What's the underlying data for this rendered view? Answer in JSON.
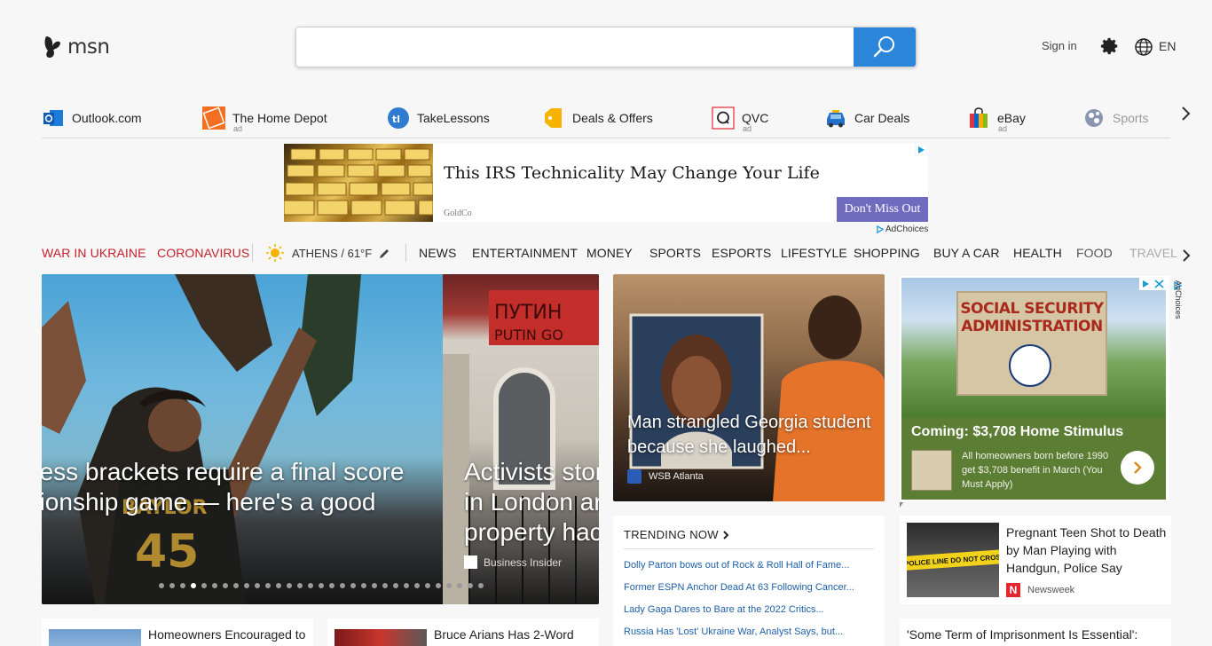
{
  "header": {
    "logo_text": "msn",
    "search_placeholder": "",
    "signin_label": "Sign in",
    "lang_label": "EN"
  },
  "quicklinks": [
    {
      "label": "Outlook.com",
      "icon": "outlook-icon",
      "ad": ""
    },
    {
      "label": "The Home Depot",
      "icon": "home-depot-icon",
      "ad": "ad"
    },
    {
      "label": "TakeLessons",
      "icon": "takelessons-icon",
      "ad": ""
    },
    {
      "label": "Deals & Offers",
      "icon": "deals-tag-icon",
      "ad": ""
    },
    {
      "label": "QVC",
      "icon": "qvc-icon",
      "ad": "ad"
    },
    {
      "label": "Car Deals",
      "icon": "car-icon",
      "ad": ""
    },
    {
      "label": "eBay",
      "icon": "ebay-bag-icon",
      "ad": "ad"
    },
    {
      "label": "Sports",
      "icon": "sports-ball-icon",
      "ad": ""
    }
  ],
  "banner_ad": {
    "title": "This IRS Technicality May Change Your Life",
    "source": "GoldCo",
    "cta": "Don't Miss Out",
    "adchoices": "AdChoices"
  },
  "nav": {
    "items": [
      "WAR IN UKRAINE",
      "CORONAVIRUS",
      "NEWS",
      "ENTERTAINMENT",
      "MONEY",
      "SPORTS",
      "ESPORTS",
      "LIFESTYLE",
      "SHOPPING",
      "BUY A CAR",
      "HEALTH",
      "FOOD",
      "TRAVEL"
    ],
    "weather": "ATHENS / 61°F"
  },
  "hero": {
    "slide1_line1": "ness brackets require a final score",
    "slide1_line2": "pionship game — here's a good",
    "slide2_line1": "Activists stor",
    "slide2_line2": "in London ar",
    "slide2_line3": "property hac",
    "slide2_source": "Business Insider",
    "dot_count": 31,
    "active_dot": 3
  },
  "story": {
    "title": "Man strangled Georgia student because she laughed...",
    "source": "WSB Atlanta"
  },
  "trending": {
    "heading": "TRENDING NOW",
    "items": [
      "Dolly Parton bows out of Rock & Roll Hall of Fame...",
      "Former ESPN Anchor Dead At 63 Following Cancer...",
      "Lady Gaga Dares to Bare at the 2022 Critics...",
      "Russia Has 'Lost' Ukraine War, Analyst Says, but..."
    ]
  },
  "side_ad": {
    "sign_text": "SOCIAL SECURITY ADMINISTRATION",
    "title": "Coming: $3,708 Home Stimulus",
    "description": "All homeowners born before 1990 get $3,708 benefit in March (You Must Apply)",
    "adchoices": "AdChoices"
  },
  "right_story": {
    "title": "Pregnant Teen Shot to Death by Man Playing with Handgun, Police Say",
    "tape_text": "POLICE LINE DO NOT CROSS",
    "source": "Newsweek"
  },
  "bottom_cards": [
    {
      "title": "Homeowners Encouraged to"
    },
    {
      "title": "Bruce Arians Has 2-Word"
    },
    {
      "title": "'Some Term of Imprisonment Is Essential':"
    }
  ]
}
